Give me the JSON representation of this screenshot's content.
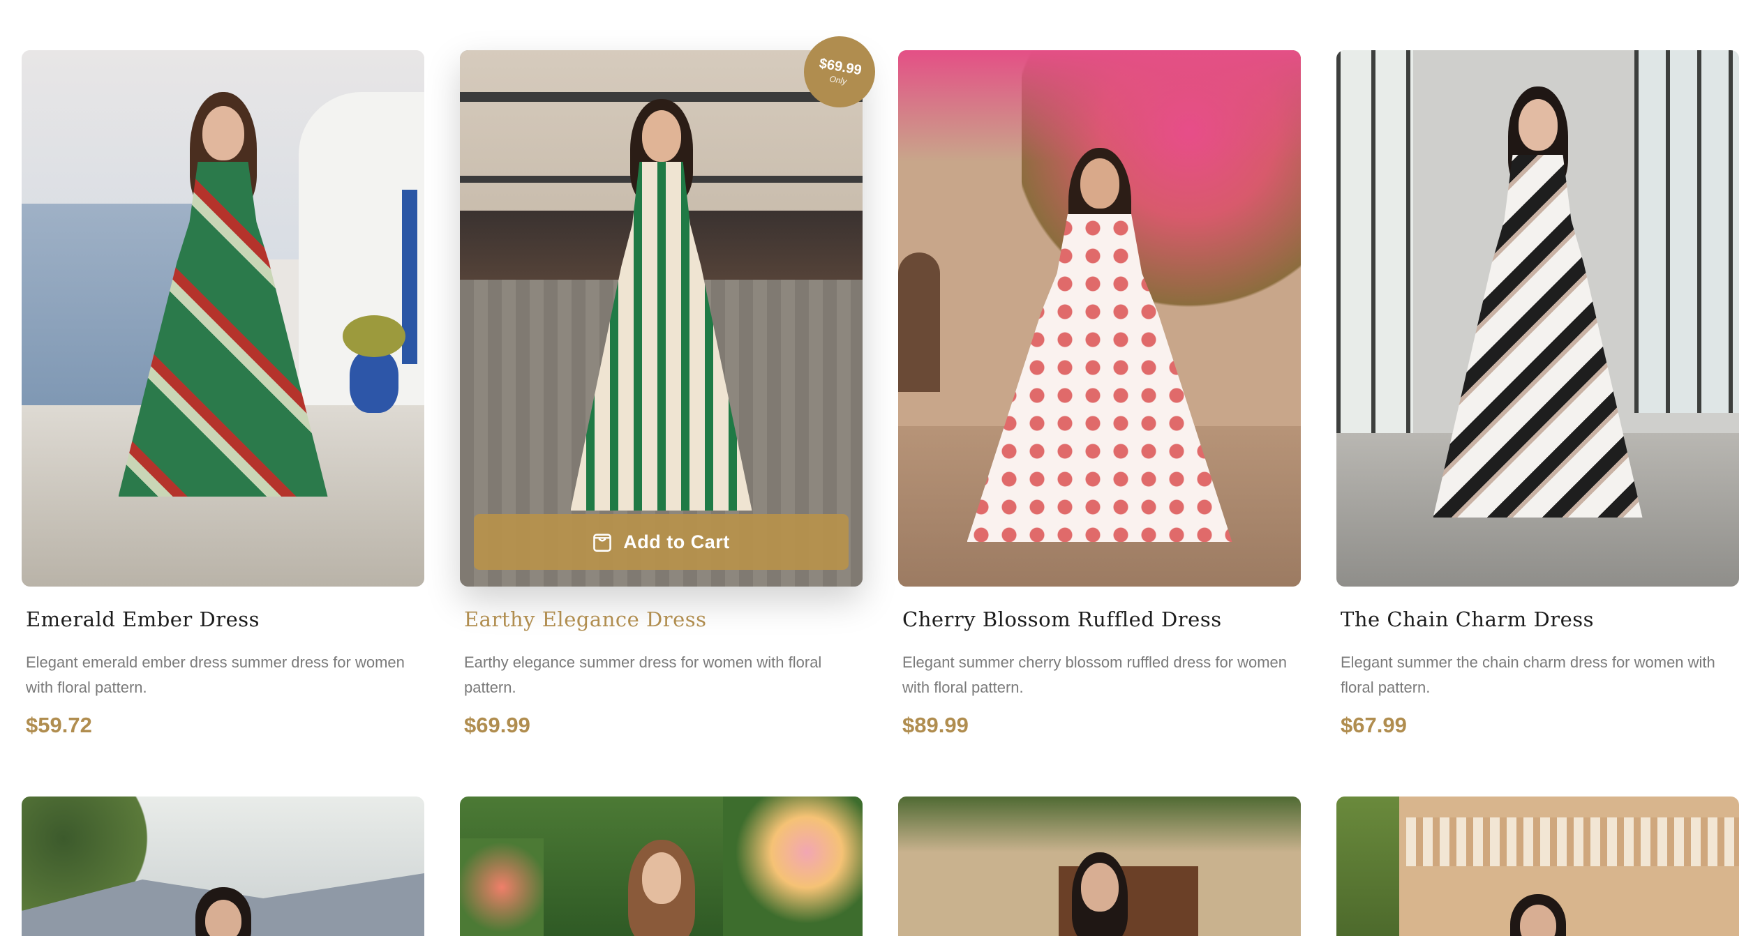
{
  "colors": {
    "accent": "#b08d4f",
    "title": "#1c1c1c",
    "description": "#7a7a7a"
  },
  "products": [
    {
      "title": "Emerald Ember Dress",
      "description": "Elegant emerald ember dress summer dress for women with floral pattern.",
      "price": "$59.72"
    },
    {
      "title": "Earthy Elegance Dress",
      "description": "Earthy elegance summer dress for women with floral pattern.",
      "price": "$69.99",
      "badge": {
        "amount": "$69.99",
        "note": "Only"
      },
      "add_to_cart": "Add to Cart"
    },
    {
      "title": "Cherry Blossom Ruffled Dress",
      "description": "Elegant summer cherry blossom ruffled dress for women with floral pattern.",
      "price": "$89.99"
    },
    {
      "title": "The Chain Charm Dress",
      "description": "Elegant summer the chain charm dress for women with floral pattern.",
      "price": "$67.99"
    }
  ],
  "icons": {
    "cart": "shopping-bag-icon"
  }
}
